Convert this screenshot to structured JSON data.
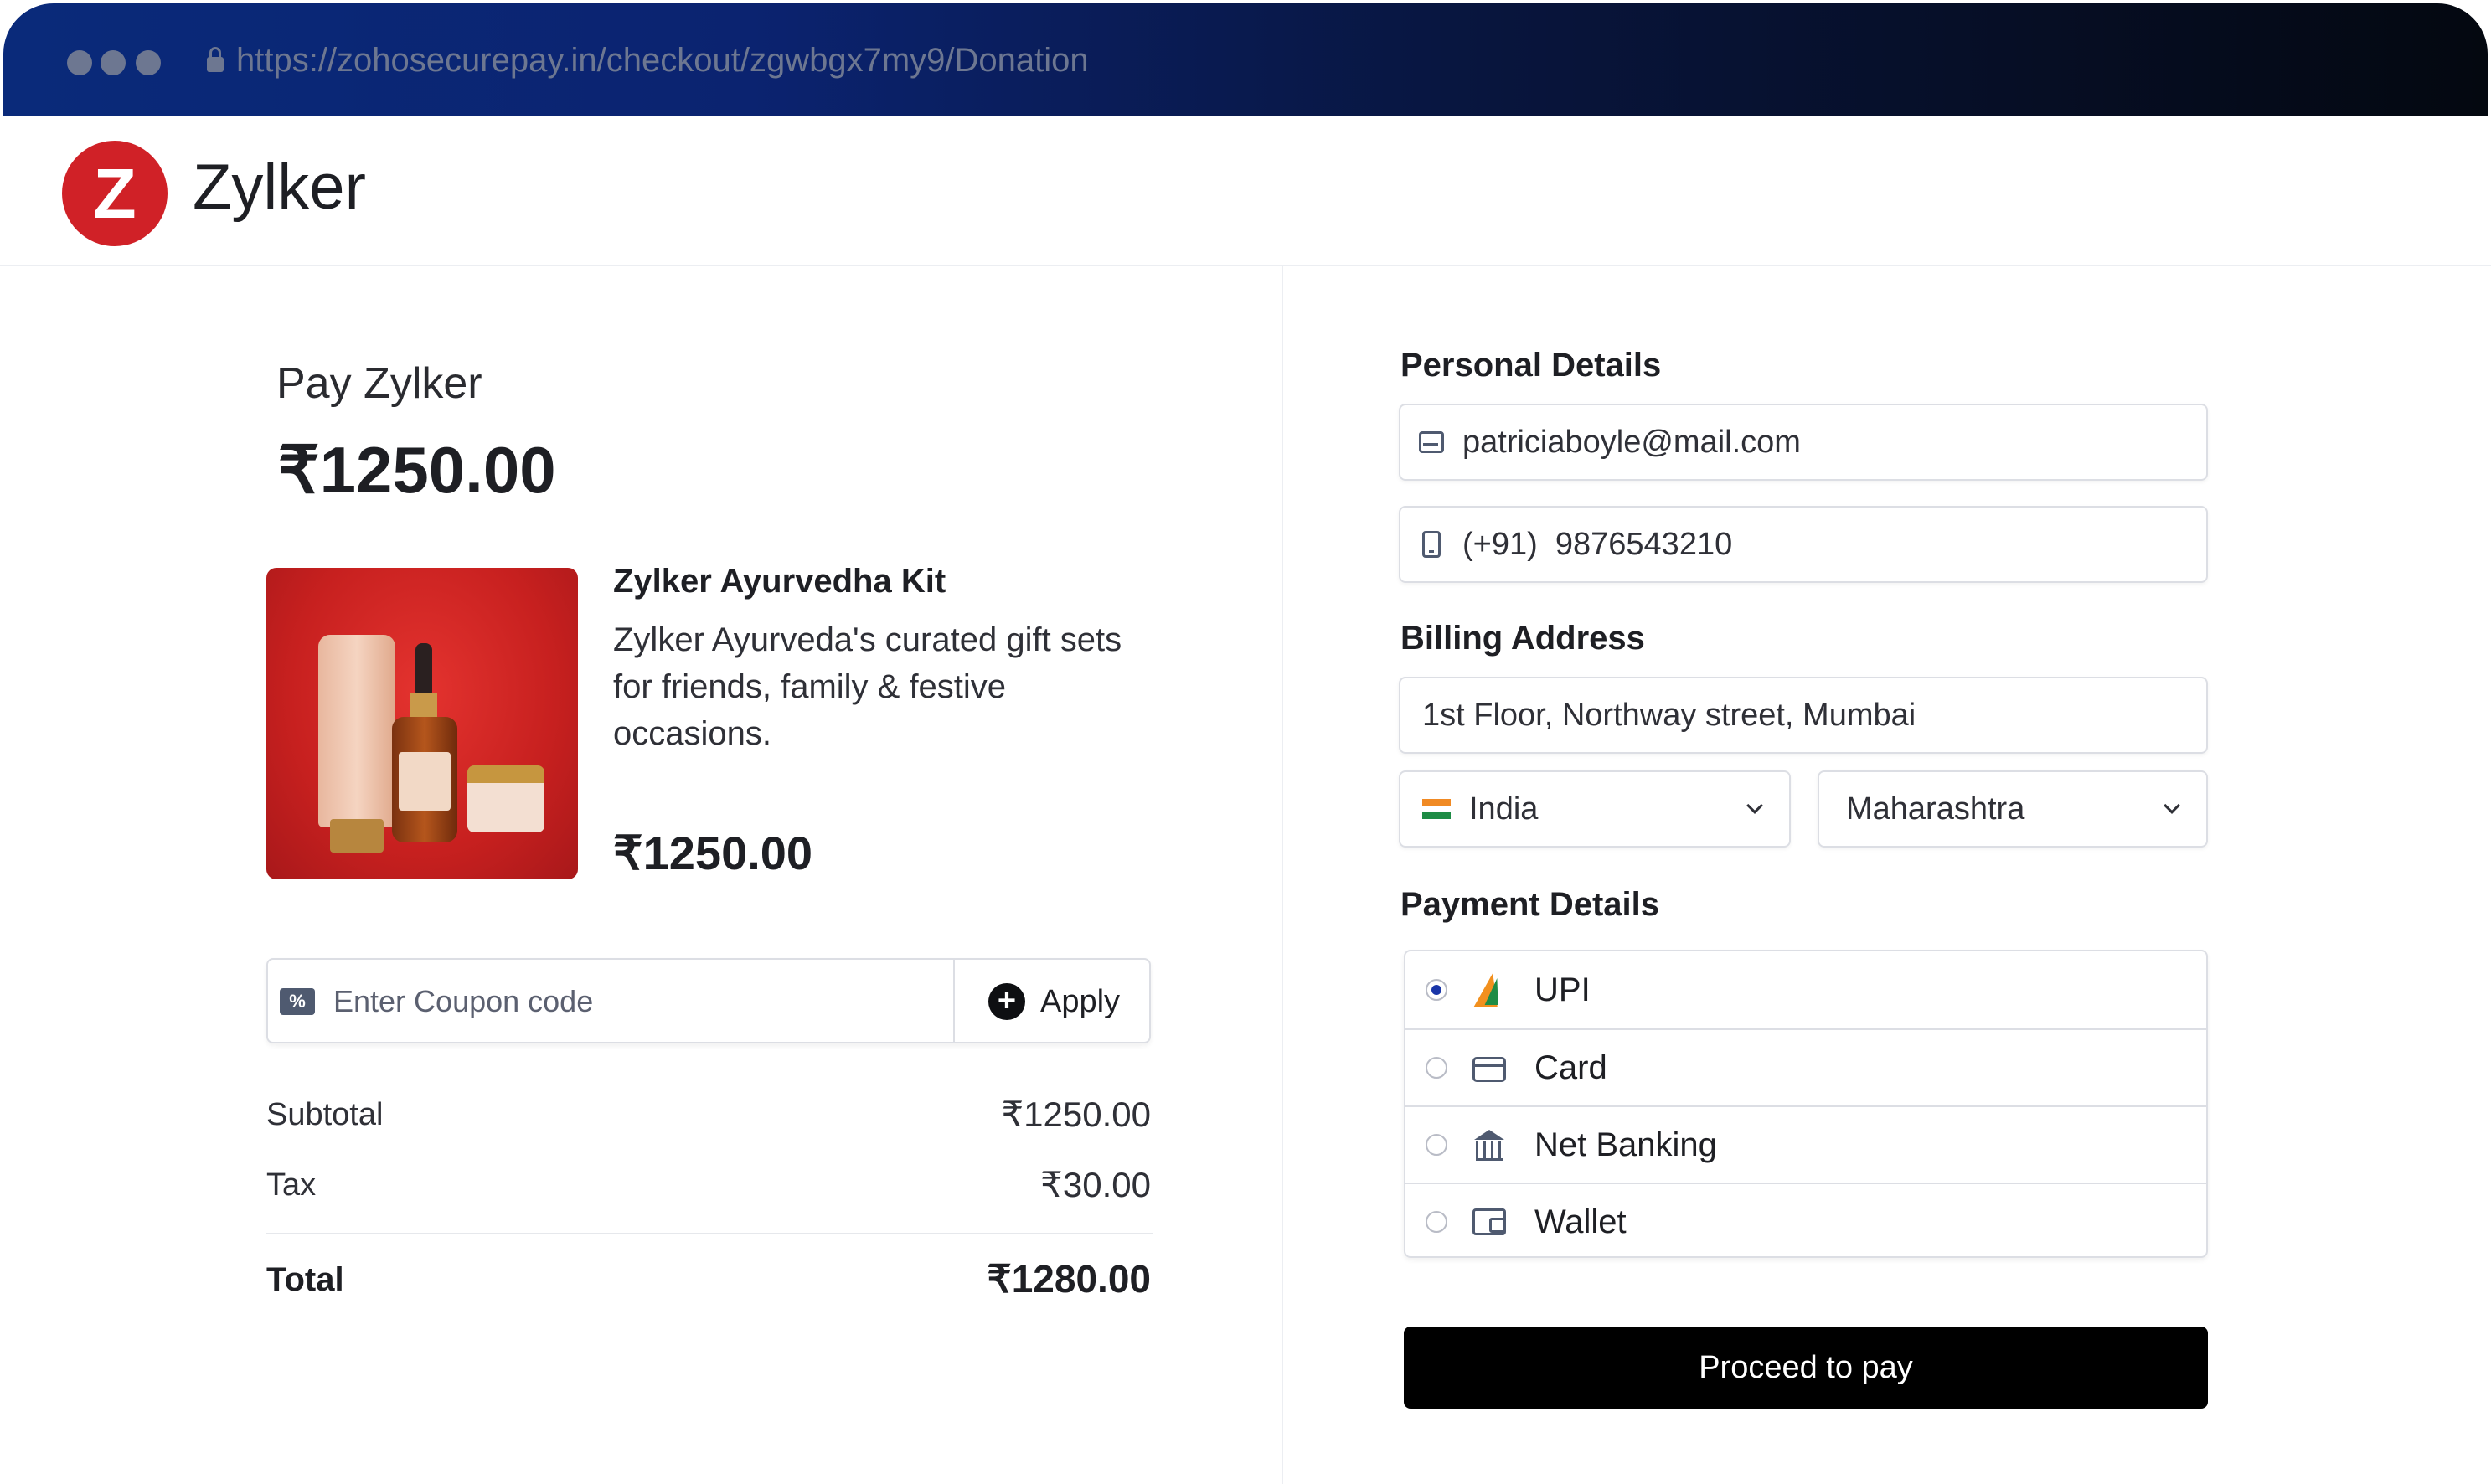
{
  "browser": {
    "url": "https://zohosecurepay.in/checkout/zgwbgx7my9/Donation"
  },
  "header": {
    "logo_letter": "Z",
    "brand_name": "Zylker"
  },
  "order": {
    "pay_title": "Pay Zylker",
    "amount": "₹1250.00",
    "product": {
      "name": "Zylker Ayurvedha Kit",
      "description": "Zylker Ayurveda's curated gift sets for friends, family & festive occasions.",
      "price": "₹1250.00"
    },
    "coupon": {
      "placeholder": "Enter Coupon code",
      "apply_label": "Apply"
    },
    "summary": {
      "subtotal_label": "Subtotal",
      "subtotal_value": "₹1250.00",
      "tax_label": "Tax",
      "tax_value": "₹30.00",
      "total_label": "Total",
      "total_value": "₹1280.00"
    }
  },
  "form": {
    "personal_title": "Personal Details",
    "email": "patriciaboyle@mail.com",
    "phone": "(+91)  9876543210",
    "billing_title": "Billing Address",
    "address": "1st Floor, Northway street, Mumbai",
    "country": "India",
    "state": "Maharashtra",
    "payment_title": "Payment Details",
    "payment_methods": [
      {
        "label": "UPI",
        "icon": "upi-icon",
        "selected": true
      },
      {
        "label": "Card",
        "icon": "card-icon",
        "selected": false
      },
      {
        "label": "Net Banking",
        "icon": "bank-icon",
        "selected": false
      },
      {
        "label": "Wallet",
        "icon": "wallet-icon",
        "selected": false
      }
    ],
    "proceed_label": "Proceed to pay"
  },
  "colors": {
    "brand_red": "#d02127",
    "radio_selected": "#1935a8",
    "button_bg": "#000000"
  }
}
